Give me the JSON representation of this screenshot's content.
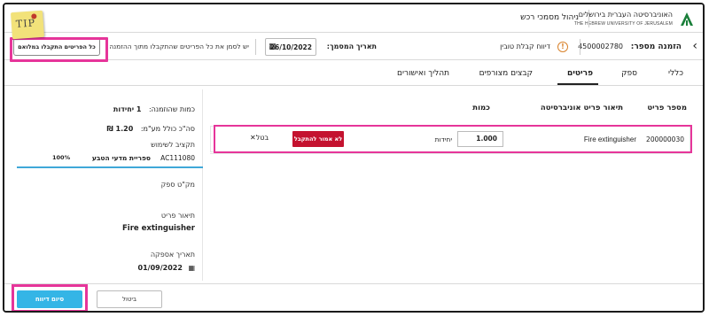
{
  "header": {
    "university_he": "האוניברסיטה העברית בירושלים",
    "university_en": "THE HEBREW UNIVERSITY OF JERUSALEM",
    "title": "ניהול מסמכי רכש"
  },
  "orderbar": {
    "order_label": "הזמנה מספר:",
    "order_number": "4500002780",
    "delivery_report": "דיווח קבלת טובין",
    "doc_date_label": "תאריך המסמך:",
    "doc_date": "26/10/2022",
    "mark_all_hint": "יש לסמן את כל הפריטים שהתקבלו מתוך ההזמנה",
    "mark_all_button": "כל הפריטים התקבלו במלואם"
  },
  "tabs": [
    {
      "label": "כללי"
    },
    {
      "label": "ספק"
    },
    {
      "label": "פריטים"
    },
    {
      "label": "קבצים מצורפים"
    },
    {
      "label": "תהליך ואישורים"
    }
  ],
  "left_panel": {
    "ordered_qty_label": "כמות שהוזמנה:",
    "ordered_qty_value": "1 יחידות",
    "total_label": "סה\"כ כולל מע\"מ:",
    "total_value": "1.20 ₪",
    "budget_label": "תקציב לשימוש",
    "budget_code": "AC111080",
    "budget_name": "ספריית מדעי הטבע",
    "budget_percent": "100%",
    "supplier_sku_label": "מק\"ט ספק",
    "item_desc_label": "תיאור פריט",
    "item_desc_value": "Fire extinguisher",
    "supply_date_label": "תאריך אספקה",
    "supply_date_value": "01/09/2022"
  },
  "table": {
    "headers": {
      "item_number": "מספר פריט",
      "university_desc": "תיאור פריט אוניברסיטה",
      "quantity": "כמות"
    },
    "rows": [
      {
        "item_number": "200000030",
        "description": "Fire extinguisher",
        "quantity": "1.000",
        "unit": "יחידות",
        "not_received_label": "לא אמור להתקבל",
        "cancel_label": "בטל"
      }
    ]
  },
  "footer": {
    "finish_label": "סיום דיווח",
    "cancel_label": "ביטול"
  },
  "tip": {
    "text": "TIP"
  },
  "colors": {
    "highlight": "#e6359a",
    "primary": "#34b5e6",
    "danger": "#c4122f",
    "warning": "#d9822b"
  }
}
